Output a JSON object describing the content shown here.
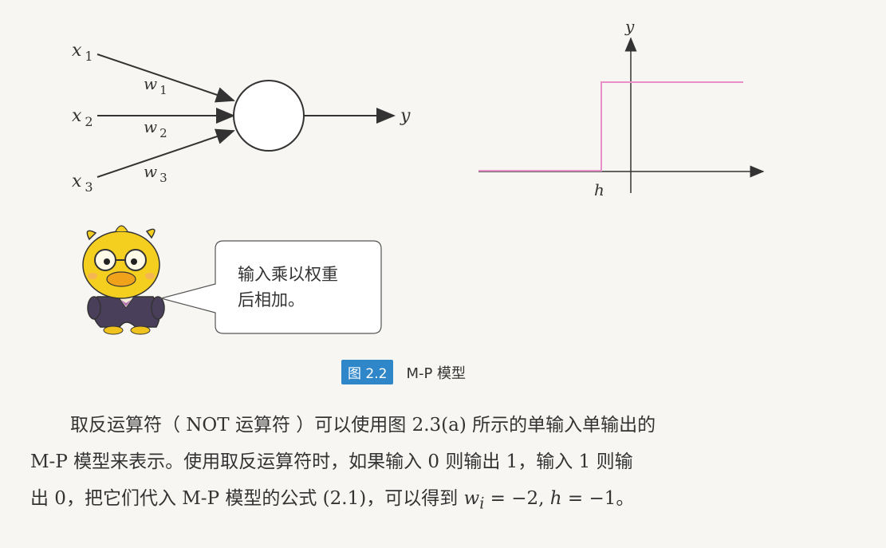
{
  "diagram": {
    "inputs": [
      "x",
      "x",
      "x"
    ],
    "input_subscripts": [
      "1",
      "2",
      "3"
    ],
    "weights": [
      "w",
      "w",
      "w"
    ],
    "weight_subscripts": [
      "1",
      "2",
      "3"
    ],
    "output_label": "y",
    "step_y_axis_label": "y",
    "step_threshold_label": "h",
    "step_color": "#e88fc8"
  },
  "bubble": {
    "line1": "输入乘以权重",
    "line2": "后相加。"
  },
  "caption": {
    "badge": "图 2.2",
    "title": "M-P 模型",
    "badge_color": "#2f86c9"
  },
  "paragraph": {
    "line1": "取反运算符（ NOT 运算符 ）可以使用图 2.3(a) 所示的单输入单输出的",
    "line2": "M-P 模型来表示。使用取反运算符时，如果输入 0 则输出 1，输入 1 则输",
    "line3_prefix": "出 0，把它们代入 M-P 模型的公式 (2.1)，可以得到 ",
    "line3_formula": "w",
    "line3_formula_sub": "i",
    "line3_formula_rest": " = −2, ",
    "line3_formula_h": "h",
    "line3_formula_end": " = −1",
    "line3_suffix": "。"
  }
}
